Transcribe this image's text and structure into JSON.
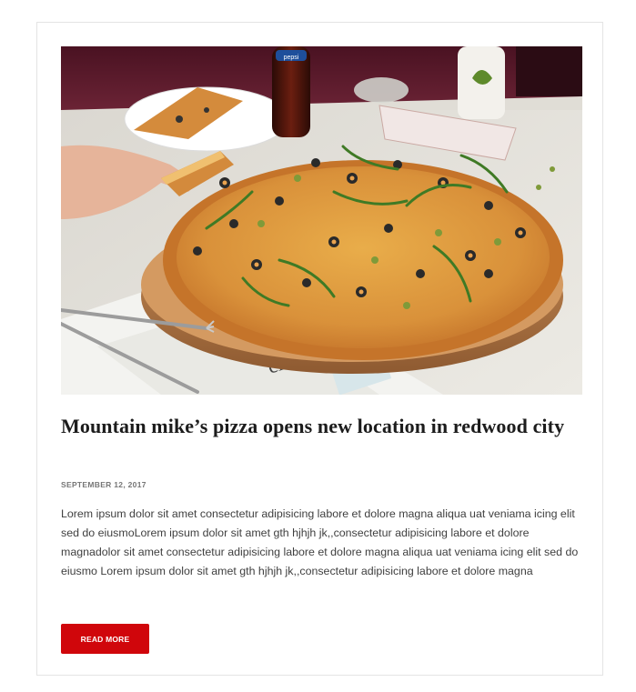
{
  "post": {
    "image_alt": "Pizza on a wooden board with a hand taking a slice",
    "title": "Mountain mike’s pizza opens new location in redwood city",
    "date": "SEPTEMBER 12, 2017",
    "excerpt": "Lorem ipsum dolor sit amet consectetur adipisicing labore et dolore magna aliqua uat veniama icing elit sed do eiusmoLorem ipsum dolor sit amet gth hjhjh jk,,consectetur adipisicing labore et dolore magnadolor sit amet consectetur adipisicing labore et dolore magna aliqua uat veniama icing elit sed do eiusmo Lorem ipsum dolor sit amet gth hjhjh jk,,consectetur adipisicing labore et dolore magna",
    "read_more_label": "READ MORE"
  },
  "image_text": {
    "bottle_label": "pepsi",
    "menu_text": "clique"
  },
  "colors": {
    "accent": "#d0060b",
    "border": "#e4e4e4",
    "title": "#1c1c1c",
    "meta": "#767676",
    "body": "#3f3f3f"
  }
}
